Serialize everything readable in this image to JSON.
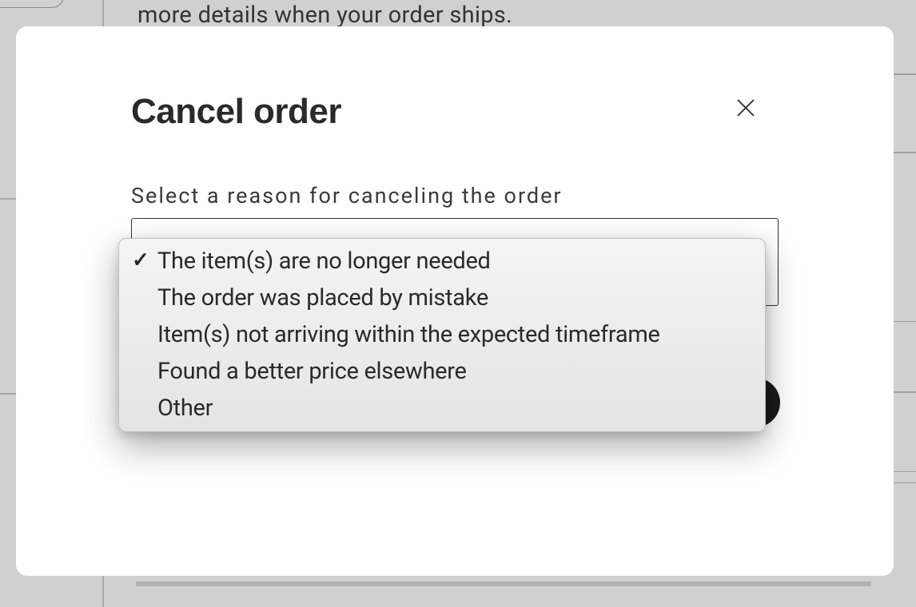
{
  "background": {
    "shipping_text_fragment": "more details when your order ships."
  },
  "modal": {
    "title": "Cancel order",
    "form_label": "Select a reason for canceling the order"
  },
  "dropdown": {
    "options": [
      {
        "label": "The item(s) are no longer needed",
        "selected": true
      },
      {
        "label": "The order was placed by mistake",
        "selected": false
      },
      {
        "label": "Item(s) not arriving within the expected timeframe",
        "selected": false
      },
      {
        "label": "Found a better price elsewhere",
        "selected": false
      },
      {
        "label": "Other",
        "selected": false
      }
    ]
  }
}
